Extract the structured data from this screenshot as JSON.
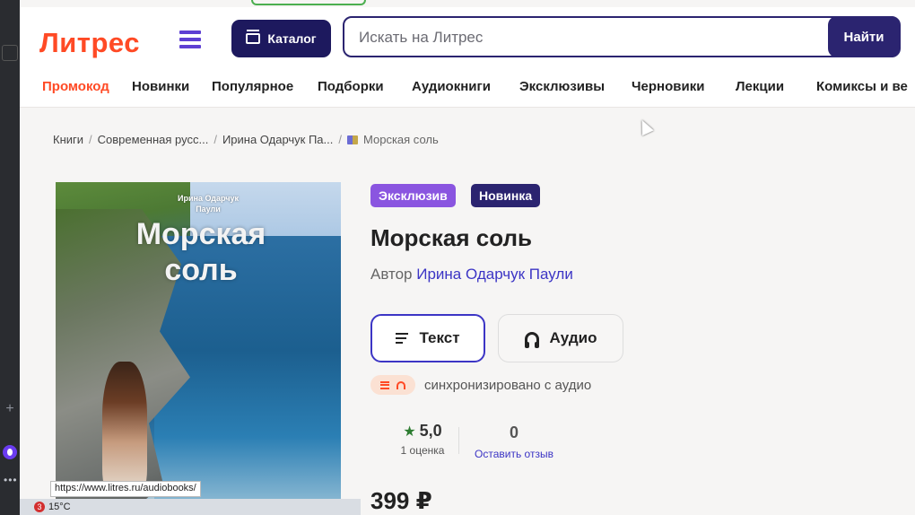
{
  "header": {
    "logo_text": "Литрес",
    "catalog_label": "Каталог",
    "search_placeholder": "Искать на Литрес",
    "search_button": "Найти"
  },
  "nav": {
    "items": [
      "Промокод",
      "Новинки",
      "Популярное",
      "Подборки",
      "Аудиокниги",
      "Эксклюзивы",
      "Черновики",
      "Лекции",
      "Комиксы и ве"
    ]
  },
  "breadcrumbs": [
    "Книги",
    "Современная русс...",
    "Ирина Одарчук Па...",
    "Морская соль"
  ],
  "cover": {
    "author": "Ирина Одарчук Паули",
    "title": "Морская соль"
  },
  "book": {
    "badges": [
      "Эксклюзив",
      "Новинка"
    ],
    "title": "Морская соль",
    "author_prefix": "Автор",
    "author_name": "Ирина Одарчук Паули",
    "formats": [
      "Текст",
      "Аудио"
    ],
    "sync_text": "синхронизировано с аудио",
    "rating_value": "5,0",
    "rating_count": "1 оценка",
    "reviews_value": "0",
    "reviews_link": "Оставить отзыв",
    "price": "399 ₽"
  },
  "status_bar": {
    "url": "https://www.litres.ru/audiobooks/",
    "weather_badge": "3",
    "temperature": "15°C"
  },
  "colors": {
    "brand_orange": "#ff4a25",
    "brand_navy": "#2b2470",
    "exclusive_purple": "#8a55e0",
    "rating_green": "#2e7d32",
    "link_blue": "#3c35c5"
  }
}
